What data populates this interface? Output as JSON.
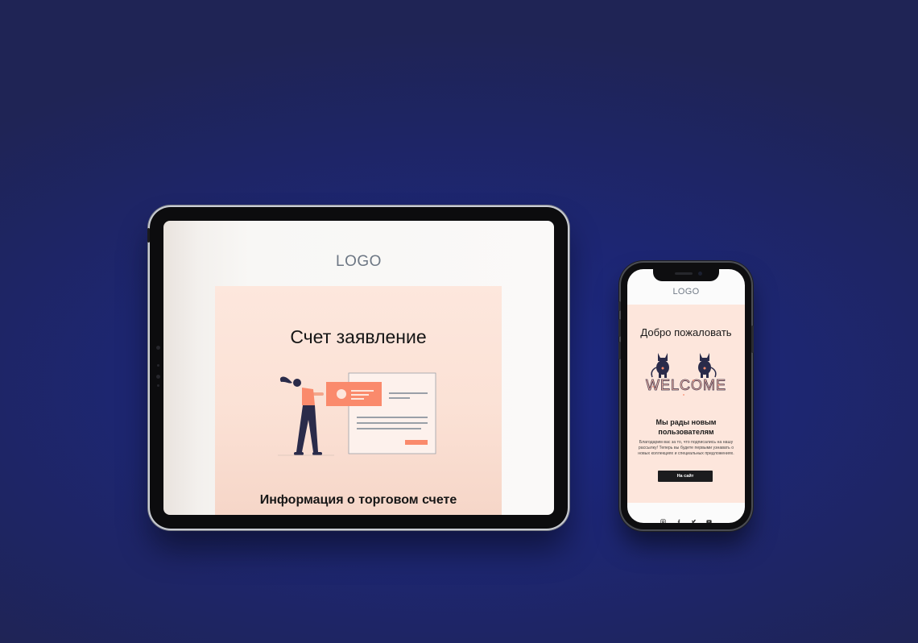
{
  "tablet": {
    "logo": "LOGO",
    "title": "Счет заявление",
    "subtitle": "Информация о торговом счете"
  },
  "phone": {
    "logo": "LOGO",
    "title": "Добро пожаловать",
    "welcome_art": "WELCOME",
    "heading": "Мы рады новым пользователям",
    "body": "Благодарим вас за то, что подписались на нашу рассылку! Теперь вы будете первыми узнавать о новых коллекциях и специальных предложениях.",
    "button_label": "На сайт",
    "social_icons": [
      "instagram-icon",
      "facebook-icon",
      "twitter-icon",
      "youtube-icon"
    ]
  },
  "colors": {
    "background": "#1d2673",
    "accent": "#fa8a6c",
    "card": "#fde6dc",
    "navy_figure": "#2a2b4a"
  }
}
